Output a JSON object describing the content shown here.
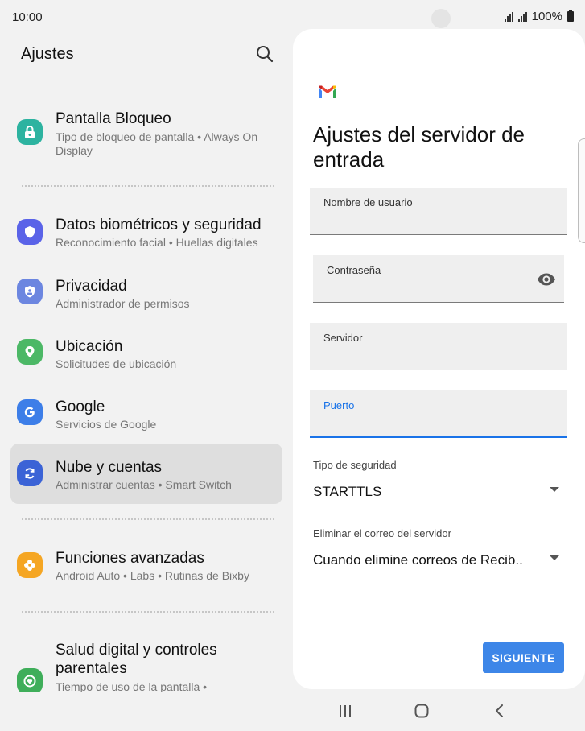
{
  "status": {
    "time": "10:00",
    "battery": "100%"
  },
  "left": {
    "title": "Ajustes",
    "items": [
      {
        "title": "Pantalla Bloqueo",
        "subtitle": "Tipo de bloqueo de pantalla  •  Always On Display",
        "icon": "lock-icon",
        "color": "#2db3a0"
      },
      {
        "title": "Datos biométricos y seguridad",
        "subtitle": "Reconocimiento facial  •  Huellas digitales",
        "icon": "shield-icon",
        "color": "#5a63e8"
      },
      {
        "title": "Privacidad",
        "subtitle": "Administrador de permisos",
        "icon": "privacy-icon",
        "color": "#6c86e0"
      },
      {
        "title": "Ubicación",
        "subtitle": "Solicitudes de ubicación",
        "icon": "location-icon",
        "color": "#4cb866"
      },
      {
        "title": "Google",
        "subtitle": "Servicios de Google",
        "icon": "google-icon",
        "color": "#3d7ee8"
      },
      {
        "title": "Nube y cuentas",
        "subtitle": "Administrar cuentas  •  Smart Switch",
        "icon": "sync-icon",
        "color": "#3b63d6"
      },
      {
        "title": "Funciones avanzadas",
        "subtitle": "Android Auto  •  Labs  •  Rutinas de Bixby",
        "icon": "puzzle-icon",
        "color": "#f5a623"
      },
      {
        "title": "Salud digital y controles parentales",
        "subtitle": "Tiempo de uso de la pantalla  •",
        "icon": "wellbeing-icon",
        "color": "#3fae5a"
      }
    ]
  },
  "card": {
    "heading": "Ajustes del servidor de entrada",
    "fields": {
      "username": "Nombre de usuario",
      "password": "Contraseña",
      "server": "Servidor",
      "port": "Puerto"
    },
    "security_label": "Tipo de seguridad",
    "security_value": "STARTTLS",
    "delete_label": "Eliminar el correo del servidor",
    "delete_value": "Cuando elimine correos de Recib..",
    "next_button": "SIGUIENTE"
  },
  "colors": {
    "accent": "#1a73e8",
    "button": "#3d86e8"
  }
}
